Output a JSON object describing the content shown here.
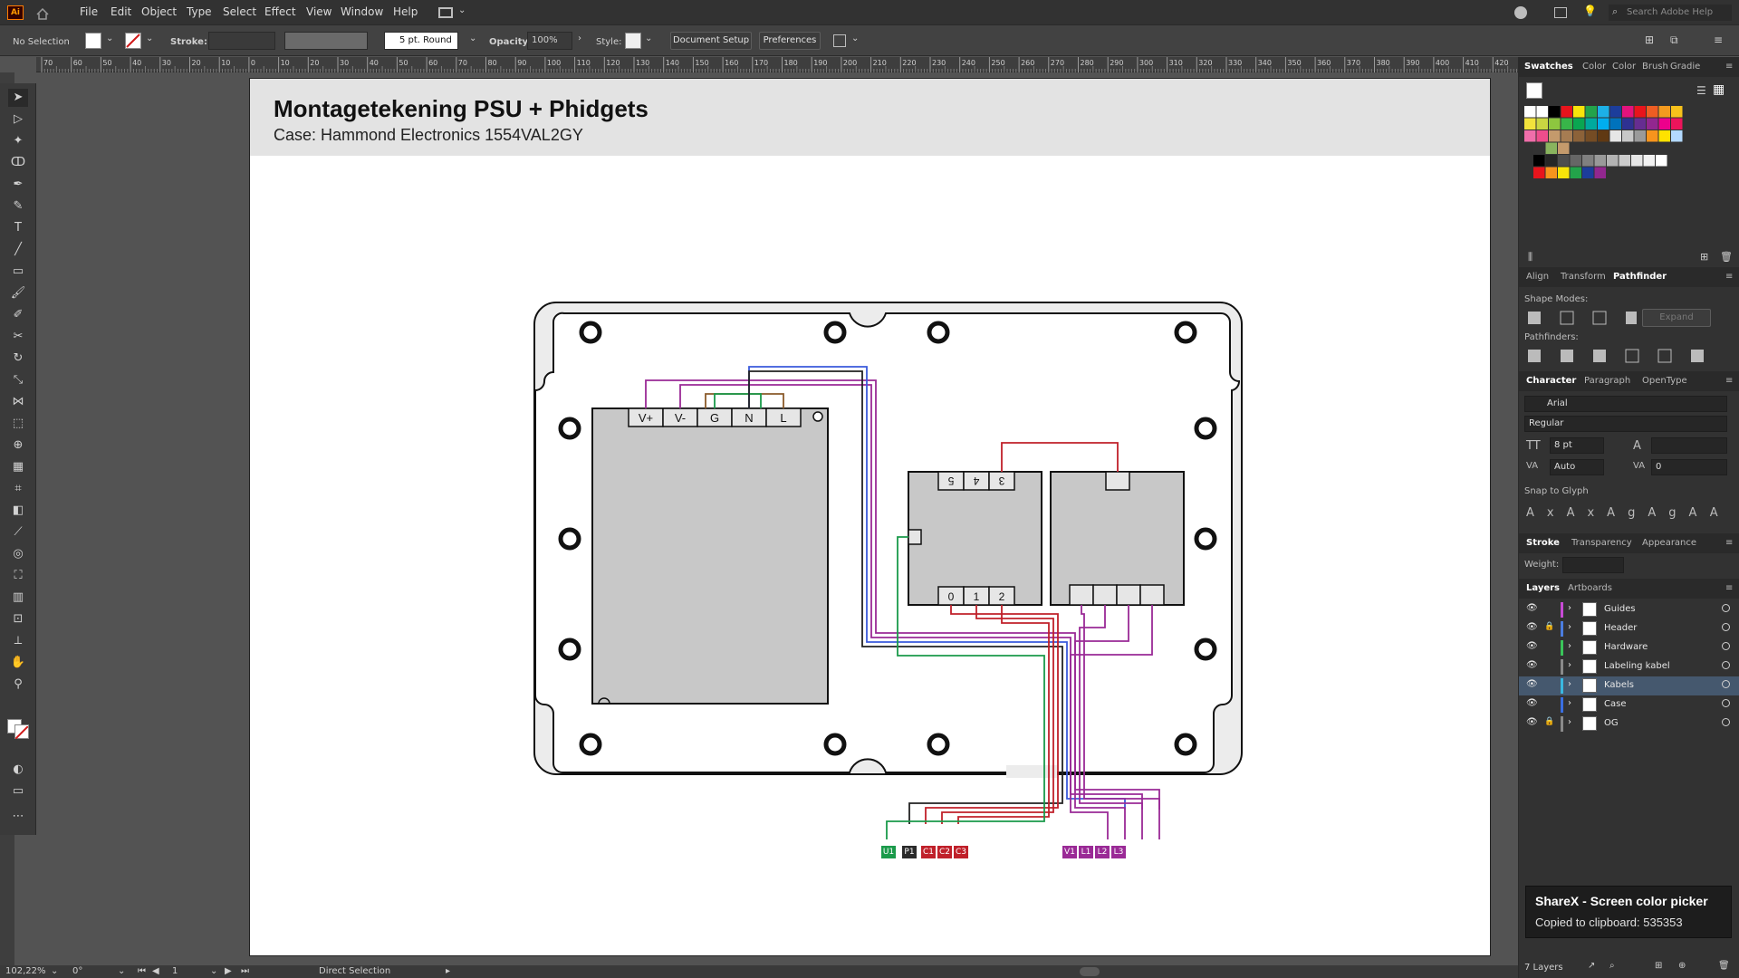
{
  "app": {
    "logo": "Ai"
  },
  "menu": [
    "File",
    "Edit",
    "Object",
    "Type",
    "Select",
    "Effect",
    "View",
    "Window",
    "Help"
  ],
  "search": {
    "placeholder": "Search Adobe Help"
  },
  "control_bar": {
    "selection": "No Selection",
    "stroke_label": "Stroke:",
    "brush": "5 pt. Round",
    "opacity_label": "Opacity:",
    "opacity_value": "100%",
    "style_label": "Style:",
    "doc_setup": "Document Setup",
    "preferences": "Preferences"
  },
  "ruler_labels": [
    "70",
    "60",
    "50",
    "40",
    "30",
    "20",
    "10",
    "0",
    "10",
    "20",
    "30",
    "40",
    "50",
    "60",
    "70",
    "80",
    "90",
    "100",
    "110",
    "120",
    "130",
    "140",
    "150",
    "160",
    "170",
    "180",
    "190",
    "200",
    "210",
    "220",
    "230",
    "240",
    "250",
    "260",
    "270",
    "280",
    "290",
    "300",
    "310",
    "320",
    "330",
    "340",
    "350",
    "360",
    "370",
    "380",
    "390",
    "400",
    "410",
    "420"
  ],
  "artboard": {
    "title": "Montagetekening PSU + Phidgets",
    "subtitle": "Case: Hammond Electronics 1554VAL2GY",
    "psu_pins": [
      "V+",
      "V-",
      "G",
      "N",
      "L"
    ],
    "relay_pins_top": [
      "5",
      "4",
      "3"
    ],
    "relay_pins_bottom": [
      "0",
      "1",
      "2"
    ],
    "cable_labels": [
      {
        "text": "U1",
        "color": "#1a9a4a"
      },
      {
        "text": "P1",
        "color": "#2a2a2a"
      },
      {
        "text": "C1",
        "color": "#c0202a"
      },
      {
        "text": "C2",
        "color": "#c0202a"
      },
      {
        "text": "C3",
        "color": "#c0202a"
      },
      {
        "text": "V1",
        "color": "#9a2a96"
      },
      {
        "text": "L1",
        "color": "#9a2a96"
      },
      {
        "text": "L2",
        "color": "#9a2a96"
      },
      {
        "text": "L3",
        "color": "#9a2a96"
      }
    ]
  },
  "panels": {
    "swatch_tabs": [
      "Swatches",
      "Color",
      "Color",
      "Brush",
      "Gradie"
    ],
    "align_tabs": [
      "Align",
      "Transform",
      "Pathfinder"
    ],
    "shape_modes": "Shape Modes:",
    "expand": "Expand",
    "pathfinders": "Pathfinders:",
    "char_tabs": [
      "Character",
      "Paragraph",
      "OpenType"
    ],
    "font": "Arial",
    "font_style": "Regular",
    "font_size": "8 pt",
    "leading": "Auto",
    "tracking": "0",
    "snap": "Snap to Glyph",
    "stroke_tabs": [
      "Stroke",
      "Transparency",
      "Appearance"
    ],
    "weight_label": "Weight:",
    "layers_tabs": [
      "Layers",
      "Artboards"
    ],
    "layers": [
      {
        "name": "Guides",
        "color": "#c84bd6",
        "selected": false
      },
      {
        "name": "Header",
        "color": "#4b7de0",
        "selected": false
      },
      {
        "name": "Hardware",
        "color": "#3ac45a",
        "selected": false
      },
      {
        "name": "Labeling kabel",
        "color": "#8a8a8a",
        "selected": false
      },
      {
        "name": "Kabels",
        "color": "#3ab8e0",
        "selected": true
      },
      {
        "name": "Case",
        "color": "#3a6ee0",
        "selected": false
      },
      {
        "name": "OG",
        "color": "#8a8a8a",
        "selected": false
      }
    ],
    "layer_count": "7 Layers"
  },
  "sharex": {
    "title": "ShareX - Screen color picker",
    "message": "Copied to clipboard: 535353"
  },
  "status": {
    "zoom": "102,22%",
    "rotation": "0°",
    "artboard": "1",
    "tool": "Direct Selection"
  }
}
